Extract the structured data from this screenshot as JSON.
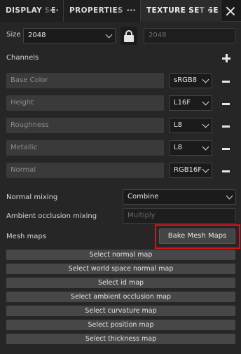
{
  "tabs": [
    {
      "label": "DISPLAY SE",
      "suffix": "···"
    },
    {
      "label": "PROPERTIES - ",
      "suffix": "···"
    },
    {
      "label": "TEXTURE SET SE",
      "suffix": "···"
    }
  ],
  "size": {
    "label": "Size",
    "value": "2048",
    "linked_value": "2048"
  },
  "channels": {
    "label": "Channels",
    "items": [
      {
        "name": "Base Color",
        "format": "sRGB8"
      },
      {
        "name": "Height",
        "format": "L16F"
      },
      {
        "name": "Roughness",
        "format": "L8"
      },
      {
        "name": "Metallic",
        "format": "L8"
      },
      {
        "name": "Normal",
        "format": "RGB16F"
      }
    ]
  },
  "normal_mixing": {
    "label": "Normal mixing",
    "value": "Combine"
  },
  "ao_mixing": {
    "label": "Ambient occlusion mixing",
    "value": "Multiply"
  },
  "mesh_maps": {
    "label": "Mesh maps",
    "bake_label": "Bake Mesh Maps",
    "highlight_color": "#d4151b",
    "buttons": [
      "Select normal map",
      "Select world space normal map",
      "Select id map",
      "Select ambient occlusion map",
      "Select curvature map",
      "Select position map",
      "Select thickness map"
    ]
  },
  "icons": {
    "lock": "lock-icon",
    "add": "plus-icon",
    "remove": "minus-icon",
    "close": "close-icon",
    "dropdown": "chevron-down-icon"
  }
}
